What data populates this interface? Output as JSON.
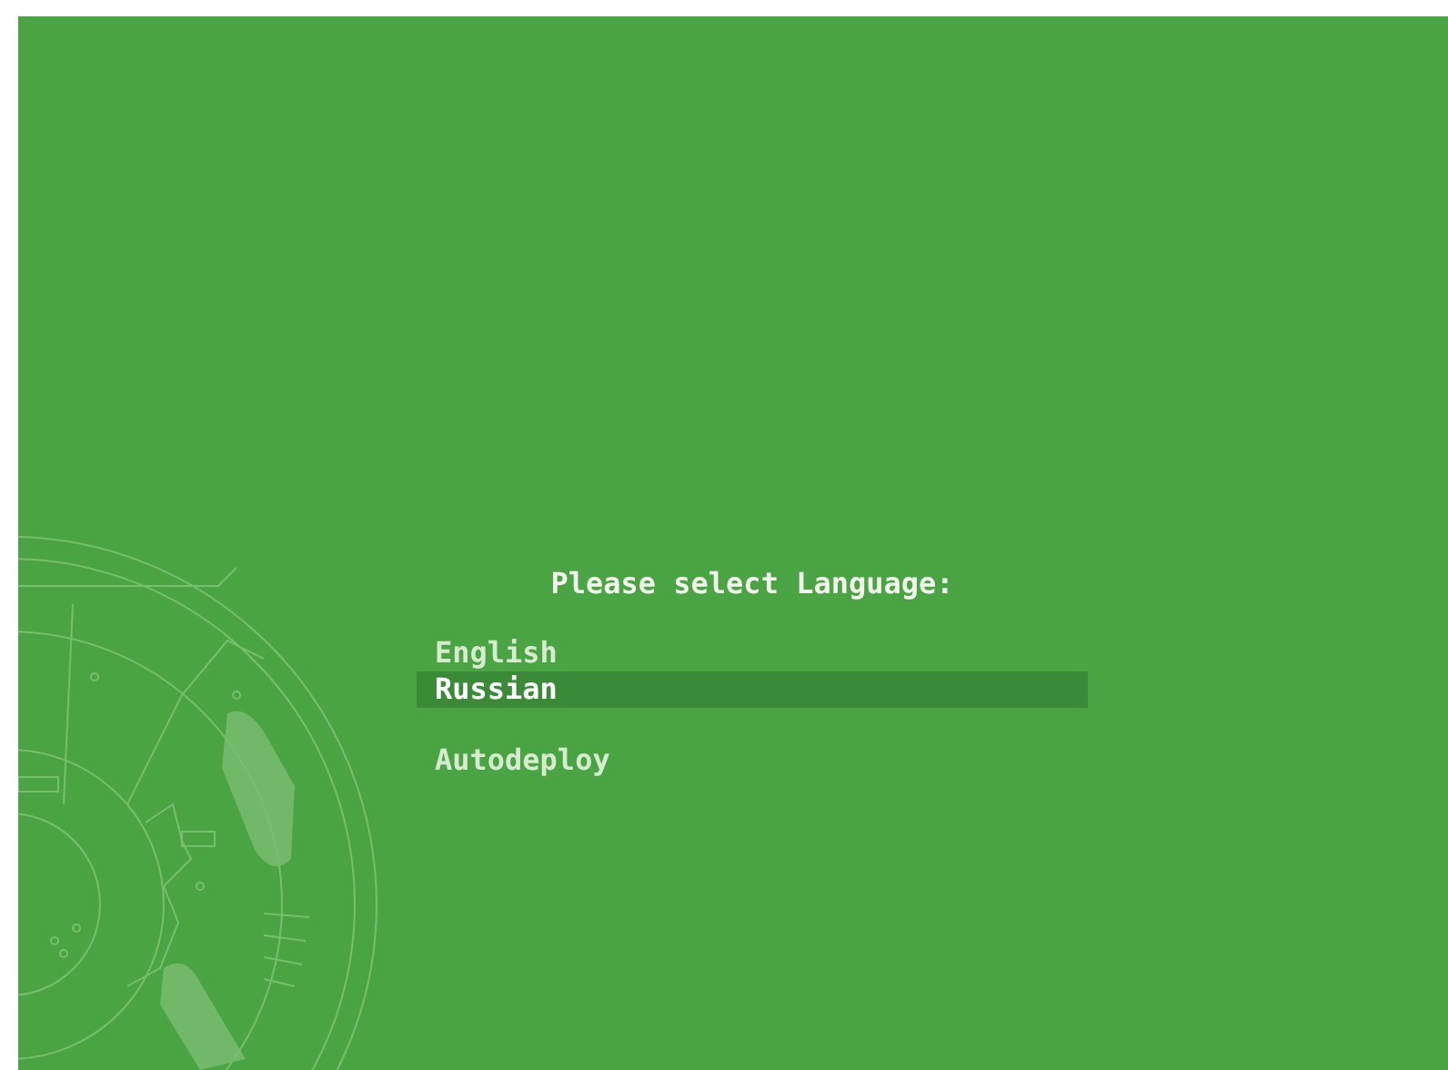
{
  "prompt": "Please select Language:",
  "menu": [
    {
      "label": "English",
      "kind": "option",
      "selected": false
    },
    {
      "label": "Russian",
      "kind": "option",
      "selected": true
    },
    {
      "kind": "gap"
    },
    {
      "label": "Autodeploy",
      "kind": "option",
      "selected": false
    }
  ]
}
